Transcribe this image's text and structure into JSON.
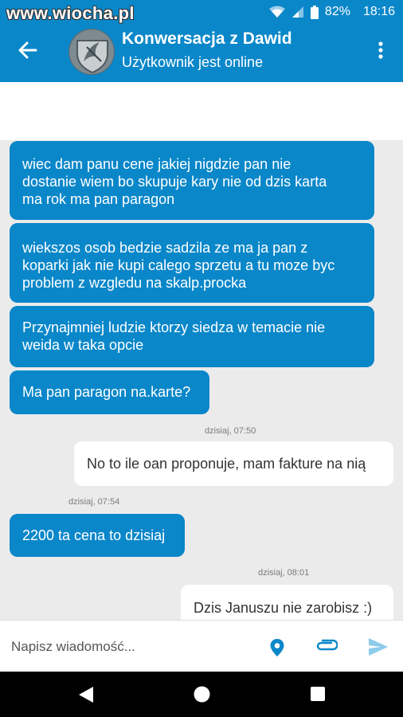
{
  "status_bar": {
    "watermark": "www.wiocha.pl",
    "battery": "82%",
    "time": "18:16"
  },
  "header": {
    "title": "Konwersacja z Dawid",
    "subtitle": "Użytkownik jest online"
  },
  "messages": [
    {
      "direction": "incoming",
      "lines": [
        "wiec dam panu cene jakiej nigdzie pan nie",
        "dostanie wiem bo skupuje kary nie od dzis karta",
        "ma rok ma pan paragon"
      ]
    },
    {
      "direction": "incoming",
      "lines": [
        "wiekszos osob bedzie sadzila ze ma ja pan z",
        "koparki jak nie kupi calego sprzetu a tu moze byc",
        "problem z wzgledu na skalp.procka"
      ]
    },
    {
      "direction": "incoming",
      "lines": [
        "Przynajmniej ludzie ktorzy siedza w temacie nie",
        "weida w taka opcie"
      ]
    },
    {
      "direction": "incoming",
      "lines": [
        "Ma pan paragon na.karte?"
      ]
    },
    {
      "direction": "outgoing",
      "timestamp": "dzisiaj, 07:50",
      "lines": [
        "No to ile oan proponuje, mam fakture na nią"
      ]
    },
    {
      "direction": "incoming",
      "timestamp": "dzisiaj, 07:54",
      "lines": [
        "2200 ta cena to dzisiaj"
      ]
    },
    {
      "direction": "outgoing",
      "timestamp": "dzisiaj, 08:01",
      "lines": [
        "Dzis Januszu nie zarobisz :)"
      ]
    }
  ],
  "composer": {
    "placeholder": "Napisz wiadomość..."
  },
  "icons": {
    "back": "arrow-left-icon",
    "menu": "more-vert-icon",
    "location": "location-pin-icon",
    "attach": "paperclip-icon",
    "send": "send-icon",
    "nav_back": "triangle-back-icon",
    "nav_home": "circle-home-icon",
    "nav_recents": "square-recents-icon"
  },
  "colors": {
    "accent": "#0a87c9",
    "chat_bg": "#ebebeb",
    "outgoing_bubble": "#ffffff",
    "send_icon": "#8ccbea"
  }
}
